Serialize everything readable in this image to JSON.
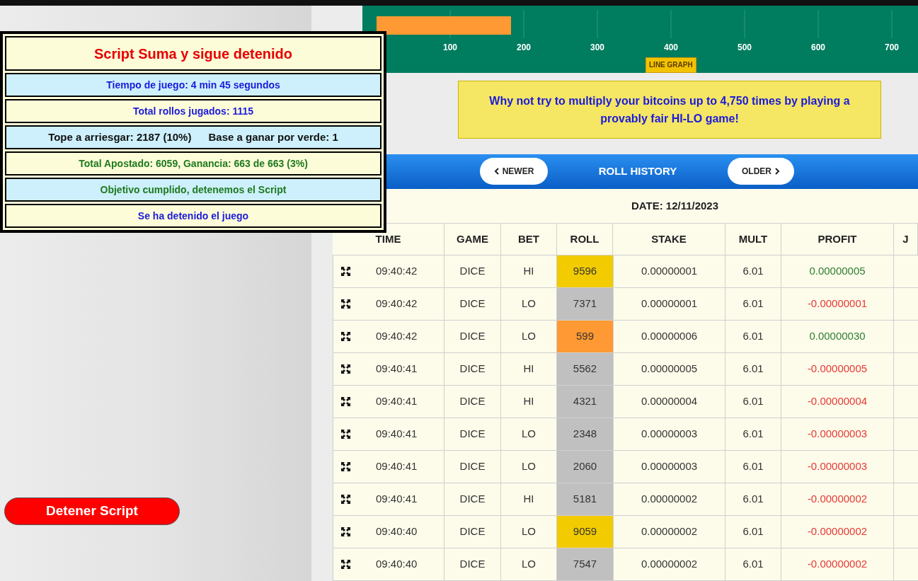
{
  "chart": {
    "axis_labels": [
      "100",
      "200",
      "300",
      "400",
      "500",
      "600",
      "700"
    ],
    "button": "LINE GRAPH"
  },
  "ad": {
    "text": "Why not try to multiply your bitcoins up to 4,750 times by playing a provably fair HI-LO game!"
  },
  "roll_history": {
    "newer": "NEWER",
    "title": "ROLL HISTORY",
    "older": "OLDER",
    "date": "DATE: 12/11/2023",
    "columns": [
      "TIME",
      "GAME",
      "BET",
      "ROLL",
      "STAKE",
      "MULT",
      "PROFIT",
      "J"
    ],
    "rows": [
      {
        "time": "09:40:42",
        "game": "DICE",
        "bet": "HI",
        "roll": {
          "value": "9596",
          "color": "#f2cb00"
        },
        "stake": "0.00000001",
        "mult": "6.01",
        "profit": {
          "value": "0.00000005",
          "color": "#2e7d32"
        }
      },
      {
        "time": "09:40:42",
        "game": "DICE",
        "bet": "LO",
        "roll": {
          "value": "7371",
          "color": "#c0c0c0"
        },
        "stake": "0.00000001",
        "mult": "6.01",
        "profit": {
          "value": "-0.00000001",
          "color": "#e53935"
        }
      },
      {
        "time": "09:40:42",
        "game": "DICE",
        "bet": "LO",
        "roll": {
          "value": "599",
          "color": "#ff9933"
        },
        "stake": "0.00000006",
        "mult": "6.01",
        "profit": {
          "value": "0.00000030",
          "color": "#2e7d32"
        }
      },
      {
        "time": "09:40:41",
        "game": "DICE",
        "bet": "HI",
        "roll": {
          "value": "5562",
          "color": "#c0c0c0"
        },
        "stake": "0.00000005",
        "mult": "6.01",
        "profit": {
          "value": "-0.00000005",
          "color": "#e53935"
        }
      },
      {
        "time": "09:40:41",
        "game": "DICE",
        "bet": "HI",
        "roll": {
          "value": "4321",
          "color": "#c0c0c0"
        },
        "stake": "0.00000004",
        "mult": "6.01",
        "profit": {
          "value": "-0.00000004",
          "color": "#e53935"
        }
      },
      {
        "time": "09:40:41",
        "game": "DICE",
        "bet": "LO",
        "roll": {
          "value": "2348",
          "color": "#c0c0c0"
        },
        "stake": "0.00000003",
        "mult": "6.01",
        "profit": {
          "value": "-0.00000003",
          "color": "#e53935"
        }
      },
      {
        "time": "09:40:41",
        "game": "DICE",
        "bet": "LO",
        "roll": {
          "value": "2060",
          "color": "#c0c0c0"
        },
        "stake": "0.00000003",
        "mult": "6.01",
        "profit": {
          "value": "-0.00000003",
          "color": "#e53935"
        }
      },
      {
        "time": "09:40:41",
        "game": "DICE",
        "bet": "HI",
        "roll": {
          "value": "5181",
          "color": "#c0c0c0"
        },
        "stake": "0.00000002",
        "mult": "6.01",
        "profit": {
          "value": "-0.00000002",
          "color": "#e53935"
        }
      },
      {
        "time": "09:40:40",
        "game": "DICE",
        "bet": "LO",
        "roll": {
          "value": "9059",
          "color": "#f2cb00"
        },
        "stake": "0.00000002",
        "mult": "6.01",
        "profit": {
          "value": "-0.00000002",
          "color": "#e53935"
        }
      },
      {
        "time": "09:40:40",
        "game": "DICE",
        "bet": "LO",
        "roll": {
          "value": "7547",
          "color": "#c0c0c0"
        },
        "stake": "0.00000002",
        "mult": "6.01",
        "profit": {
          "value": "-0.00000002",
          "color": "#e53935"
        }
      }
    ]
  },
  "script_panel": {
    "lines": [
      {
        "parts": [
          "Script Suma y sigue detenido"
        ],
        "color": "#e60000"
      },
      {
        "parts": [
          "Tiempo de juego: 4 min 45 segundos"
        ],
        "color": "#1a1adb"
      },
      {
        "parts": [
          "Total rollos jugados: 1115"
        ],
        "color": "#1a1adb"
      },
      {
        "parts": [
          "Tope a arriesgar: 2187  (10%)",
          "Base a ganar por verde: 1"
        ],
        "color": "#111111"
      },
      {
        "parts": [
          "Total Apostado: 6059, Ganancia: 663 de 663 (3%)"
        ],
        "color": "#1f7a1f"
      },
      {
        "parts": [
          "Objetivo cumplido, detenemos el Script"
        ],
        "color": "#1f7a1f"
      },
      {
        "parts": [
          "Se ha detenido el juego"
        ],
        "color": "#1a1adb"
      }
    ]
  },
  "stop_button": "Detener Script"
}
